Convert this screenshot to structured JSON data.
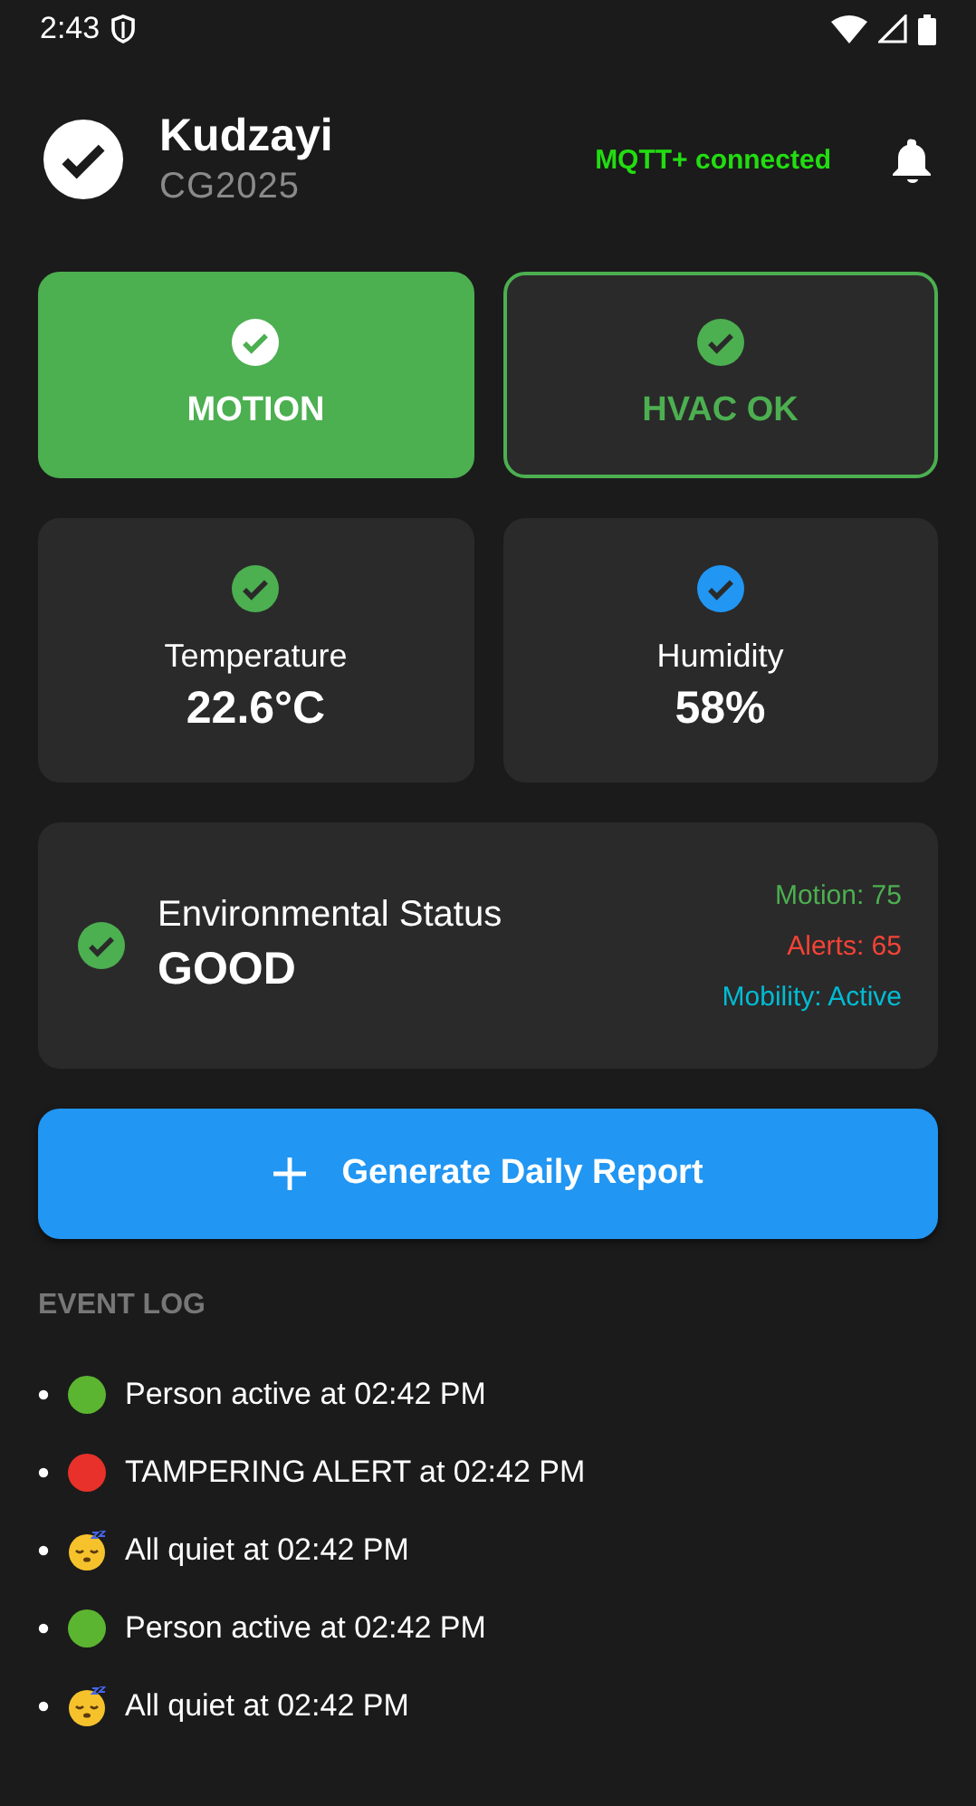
{
  "status_bar": {
    "time": "2:43"
  },
  "header": {
    "name": "Kudzayi",
    "subtitle": "CG2025",
    "connection": "MQTT+ connected"
  },
  "status_tiles": [
    {
      "label": "MOTION",
      "active": true
    },
    {
      "label": "HVAC OK",
      "active": false
    }
  ],
  "sensors": [
    {
      "label": "Temperature",
      "value": "22.6°C",
      "color": "#4caf50"
    },
    {
      "label": "Humidity",
      "value": "58%",
      "color": "#2196f3"
    }
  ],
  "environment": {
    "title": "Environmental Status",
    "status": "GOOD",
    "stats": [
      {
        "text": "Motion: 75",
        "color": "#4caf50"
      },
      {
        "text": "Alerts: 65",
        "color": "#f44336"
      },
      {
        "text": "Mobility: Active",
        "color": "#00bcd4"
      }
    ]
  },
  "report_button": {
    "label": "Generate Daily Report"
  },
  "event_log": {
    "title": "EVENT LOG",
    "events": [
      {
        "kind": "active",
        "text": "Person active at 02:42 PM"
      },
      {
        "kind": "alert",
        "text": "TAMPERING ALERT at 02:42 PM"
      },
      {
        "kind": "quiet",
        "text": "All quiet at 02:42 PM"
      },
      {
        "kind": "active",
        "text": "Person active at 02:42 PM"
      },
      {
        "kind": "quiet",
        "text": "All quiet at 02:42 PM"
      }
    ]
  }
}
